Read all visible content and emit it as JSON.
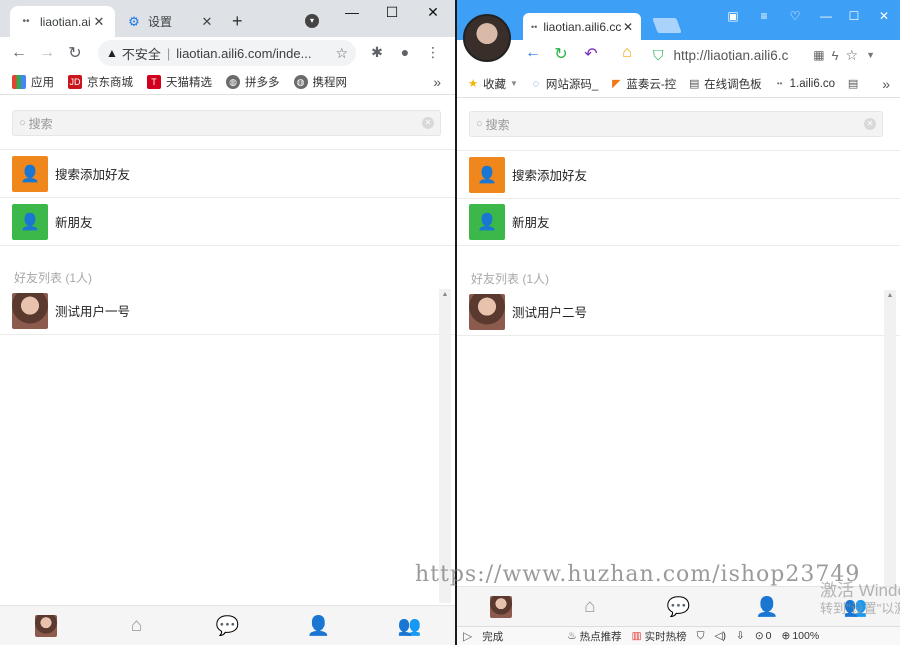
{
  "left_browser": {
    "tabs": [
      {
        "title": "liaotian.aili",
        "favicon": "app-favicon"
      },
      {
        "title": "设置",
        "favicon": "gear-icon"
      }
    ],
    "new_tab": "+",
    "window_controls": {
      "minimize": "—",
      "maximize": "☐",
      "close": "✕"
    },
    "address": {
      "insecure_label": "不安全",
      "url": "liaotian.aili6.com/inde..."
    },
    "bookmarks": [
      {
        "label": "应用",
        "icon": "apps-grid-icon",
        "color": "#e34133"
      },
      {
        "label": "京东商城",
        "icon": "jd-icon",
        "color": "#c9161d"
      },
      {
        "label": "天猫精选",
        "icon": "tmall-icon",
        "color": "#d1001c"
      },
      {
        "label": "拼多多",
        "icon": "globe-icon",
        "color": "#5f6368"
      },
      {
        "label": "携程网",
        "icon": "globe-icon",
        "color": "#5f6368"
      }
    ]
  },
  "right_browser": {
    "tab": {
      "title": "liaotian.aili6.cc"
    },
    "address": {
      "url": "http://liaotian.aili6.c"
    },
    "bookmarks": [
      {
        "label": "收藏",
        "icon": "star-icon"
      },
      {
        "label": "网站源码_",
        "icon": "globe-icon"
      },
      {
        "label": "蓝奏云-控",
        "icon": "flag-icon"
      },
      {
        "label": "在线调色板",
        "icon": "doc-icon"
      },
      {
        "label": "1.aili6.co",
        "icon": "app-favicon"
      },
      {
        "label": "",
        "icon": "doc-icon"
      }
    ],
    "status": {
      "left": "完成",
      "hot_recommend": "热点推荐",
      "realtime_hot": "实时热榜",
      "count": "0",
      "zoom": "100%"
    }
  },
  "app_left": {
    "search_placeholder": "搜索",
    "add_friend": "搜索添加好友",
    "new_friend": "新朋友",
    "section_title": "好友列表 (1人)",
    "friend_name": "测试用户一号"
  },
  "app_right": {
    "search_placeholder": "搜索",
    "add_friend": "搜索添加好友",
    "new_friend": "新朋友",
    "section_title": "好友列表 (1人)",
    "friend_name": "测试用户二号"
  },
  "colors": {
    "accent_purple": "#4b10a8",
    "orange_icon": "#f0871d",
    "green_icon": "#3cb84a",
    "browser_blue": "#3d9ff5"
  },
  "watermark": "https://www.huzhan.com/ishop23749",
  "windows_activation": {
    "line1": "激活 Windo",
    "line2": "转到\"设置\"以激"
  }
}
